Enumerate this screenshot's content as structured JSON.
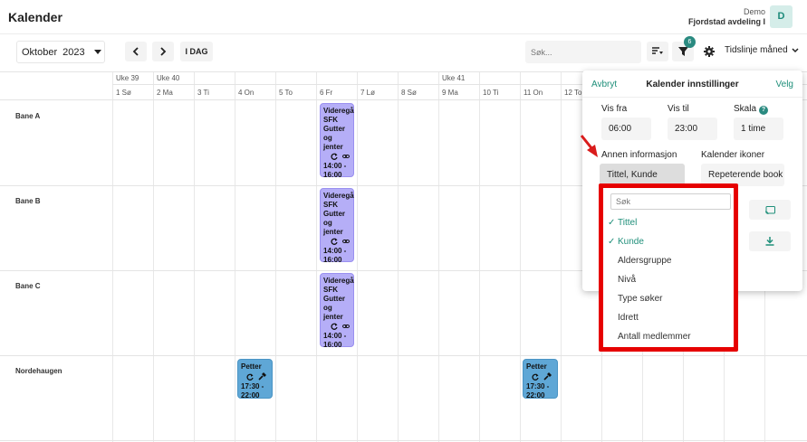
{
  "app": {
    "title": "Kalender"
  },
  "user": {
    "label": "Demo",
    "org": "Fjordstad avdeling I",
    "initial": "D"
  },
  "toolbar": {
    "month": "Oktober",
    "year": "2023",
    "prev_icon": "chevron-left-icon",
    "next_icon": "chevron-right-icon",
    "today_label": "I DAG",
    "search_placeholder": "Søk...",
    "filter_badge": "6",
    "view_label": "Tidslinje måned"
  },
  "calendar": {
    "weeks": [
      "Uke 39",
      "Uke 40",
      "Uke 41"
    ],
    "days": [
      "1 Sø",
      "2 Ma",
      "3 Ti",
      "4 On",
      "5 To",
      "6 Fr",
      "7 Lø",
      "8 Sø",
      "9 Ma",
      "10 Ti",
      "11 On",
      "12 To"
    ],
    "resources": [
      "Bane A",
      "Bane B",
      "Bane C",
      "Nordehaugen"
    ],
    "events": [
      {
        "title_lines": [
          "Videregå",
          "SFK",
          "Gutter",
          "og",
          "jenter"
        ],
        "time_lines": [
          "14:00 -",
          "16:00"
        ],
        "color": "#b5aef7"
      },
      {
        "title_lines": [
          "Videregå",
          "SFK",
          "Gutter",
          "og",
          "jenter"
        ],
        "time_lines": [
          "14:00 -",
          "16:00"
        ],
        "color": "#b5aef7"
      },
      {
        "title_lines": [
          "Videregå",
          "SFK",
          "Gutter",
          "og",
          "jenter"
        ],
        "time_lines": [
          "14:00 -",
          "16:00"
        ],
        "color": "#b5aef7"
      },
      {
        "title_lines": [
          "Petter"
        ],
        "time_lines": [
          "17:30 -",
          "22:00"
        ],
        "color": "#5fa7d6"
      },
      {
        "title_lines": [
          "Petter"
        ],
        "time_lines": [
          "17:30 -",
          "22:00"
        ],
        "color": "#5fa7d6"
      }
    ]
  },
  "settings": {
    "cancel_label": "Avbryt",
    "title": "Kalender innstillinger",
    "confirm_label": "Velg",
    "from_label": "Vis fra",
    "from_value": "06:00",
    "to_label": "Vis til",
    "to_value": "23:00",
    "scale_label": "Skala",
    "scale_value": "1 time",
    "help_glyph": "?",
    "other_info_label": "Annen informasjon",
    "other_info_value": "Tittel, Kunde",
    "icons_label": "Kalender ikoner",
    "icons_value": "Repeterende book"
  },
  "dropdown": {
    "search_placeholder": "Søk",
    "check_glyph": "✓",
    "options": [
      {
        "label": "Tittel",
        "selected": true
      },
      {
        "label": "Kunde",
        "selected": true
      },
      {
        "label": "Aldersgruppe",
        "selected": false
      },
      {
        "label": "Nivå",
        "selected": false
      },
      {
        "label": "Type søker",
        "selected": false
      },
      {
        "label": "Idrett",
        "selected": false
      },
      {
        "label": "Antall medlemmer",
        "selected": false
      }
    ]
  },
  "colors": {
    "accent": "#1f8f7a",
    "highlight": "#e60000",
    "event_purple": "#b5aef7",
    "event_blue": "#5fa7d6"
  }
}
